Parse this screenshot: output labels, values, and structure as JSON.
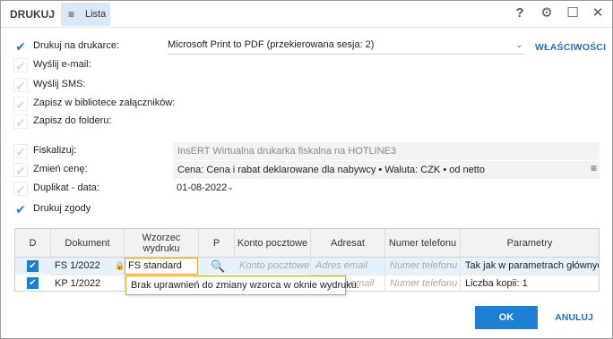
{
  "window": {
    "title": "DRUKUJ",
    "tab_label": "Lista",
    "tab_icon": "≡"
  },
  "titlebar_icons": [
    {
      "name": "help-icon",
      "glyph": "?"
    },
    {
      "name": "gear-icon",
      "glyph": "⚙"
    },
    {
      "name": "maximize-icon",
      "glyph": "☐"
    },
    {
      "name": "close-icon",
      "glyph": "✕"
    }
  ],
  "options": {
    "print_on_printer": {
      "label": "Drukuj na drukarce:",
      "checked": true
    },
    "send_email": {
      "label": "Wyślij e-mail:",
      "checked": false
    },
    "send_sms": {
      "label": "Wyślij SMS:",
      "checked": false
    },
    "save_library": {
      "label": "Zapisz w bibliotece załączników:",
      "checked": false
    },
    "save_folder": {
      "label": "Zapisz do folderu:",
      "checked": false
    },
    "fiscalize": {
      "label": "Fiskalizuj:",
      "checked": false
    },
    "change_price": {
      "label": "Zmień cenę:",
      "checked": false
    },
    "duplicate_date": {
      "label": "Duplikat - data:",
      "checked": false
    },
    "print_consents": {
      "label": "Drukuj zgody",
      "checked": true
    }
  },
  "printer": {
    "value": "Microsoft Print to PDF (przekierowana sesja: 2)",
    "properties_label": "WŁAŚCIWOŚCI"
  },
  "fiscal_printer": "InsERT Wirtualna drukarka fiskalna na HOTLINE3",
  "price_settings": "Cena: Cena i rabat deklarowane dla nabywcy • Waluta: CZK • od netto",
  "duplicate_date_value": "01-08-2022",
  "table": {
    "headers": [
      "D",
      "Dokument",
      "Wzorzec wydruku",
      "P",
      "Konto pocztowe",
      "Adresat",
      "Numer telefonu",
      "Parametry"
    ],
    "rows": [
      {
        "checked": true,
        "document": "FS 1/2022",
        "template": "FS standard",
        "mail_account": "Konto pocztowe",
        "recipient": "Adres email",
        "phone": "Numer telefonu",
        "params": "Tak jak w parametrach głównych"
      },
      {
        "checked": true,
        "document": "KP 1/2022",
        "template": "",
        "mail_account": "",
        "recipient": "email",
        "phone": "Numer telefonu",
        "params": "Liczba kopii: 1"
      }
    ]
  },
  "tooltip": "Brak uprawnień do zmiany wzorca w oknie wydruku.",
  "buttons": {
    "ok": "OK",
    "cancel": "ANULUJ"
  },
  "colors": {
    "accent": "#1b7fd6",
    "tab_bg": "#d9e8f6",
    "warning_border": "#e3a33a"
  }
}
